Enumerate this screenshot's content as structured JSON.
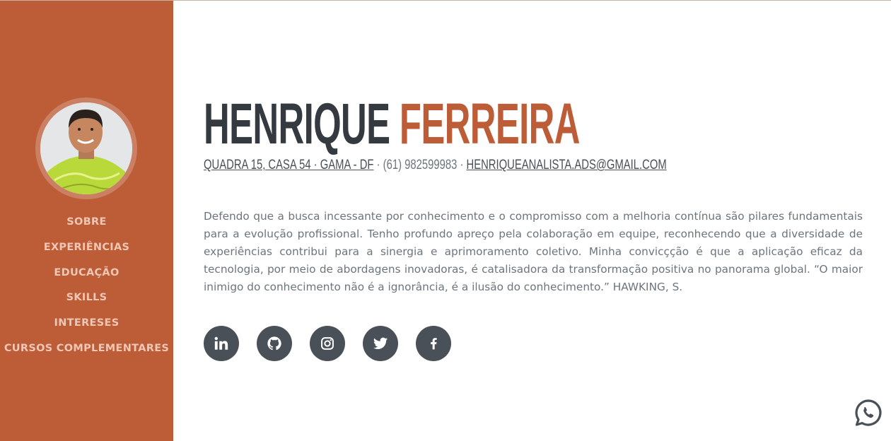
{
  "sidebar": {
    "nav": [
      {
        "label": "SOBRE"
      },
      {
        "label": "EXPERIÊNCIAS"
      },
      {
        "label": "EDUCAÇÃO"
      },
      {
        "label": "SKILLS"
      },
      {
        "label": "INTERESES"
      },
      {
        "label": "CURSOS COMPLEMENTARES"
      }
    ]
  },
  "header": {
    "first_name": "HENRIQUE",
    "last_name": "FERREIRA",
    "address": "QUADRA 15, CASA 54 · GAMA - DF",
    "separator": "·",
    "phone": "(61) 982599983",
    "email": "HENRIQUEANALISTA.ADS@GMAIL.COM"
  },
  "bio": "Defendo que a busca incessante por conhecimento e o compromisso com a melhoria contínua são pilares fundamentais para a evolução profissional. Tenho profundo apreço pela colaboração em equipe, reconhecendo que a diversidade de experiências contribui para a sinergia e aprimoramento coletivo. Minha convicçção é que a aplicação eficaz da tecnologia, por meio de abordagens inovadoras, é catalisadora da transformação positiva no panorama global. “O maior inimigo do conhecimento não é a ignorância, é a ilusão do conhecimento.” HAWKING, S.",
  "social": [
    "linkedin-icon",
    "github-icon",
    "instagram-icon",
    "twitter-icon",
    "facebook-icon"
  ],
  "floating": {
    "icon": "whatsapp-icon"
  },
  "colors": {
    "accent": "#bd5d38",
    "dark": "#343a40",
    "social_bg": "#495057",
    "text": "#6c757d",
    "nav_text": "#f0c6b5"
  }
}
